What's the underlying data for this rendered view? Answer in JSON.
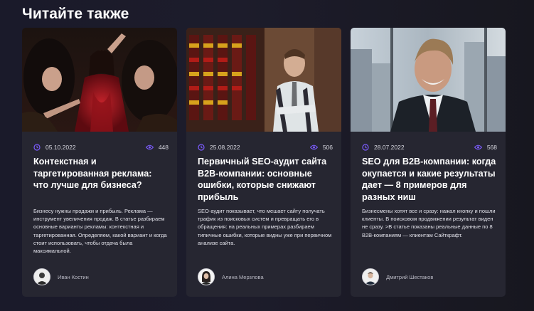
{
  "section": {
    "title": "Читайте также"
  },
  "colors": {
    "accent": "#7c5cff",
    "card_bg": "#262631",
    "page_bg": "#1b1a28"
  },
  "cards": [
    {
      "date": "05.10.2022",
      "views": "448",
      "title": "Контекстная и таргетированная реклама: что лучше для бизнеса?",
      "description": "Бизнесу нужны продажи и прибыль. Реклама — инструмент увеличения продаж. В статье разбираем основные варианты рекламы: контекстная и таргетированная. Определяем, какой вариант и когда стоит использовать, чтобы отдача была максимальной.",
      "author": "Иван Костин"
    },
    {
      "date": "25.08.2022",
      "views": "506",
      "title": "Первичный SEO-аудит сайта B2B-компании: основные ошибки, которые снижают прибыль",
      "description": "SEO-аудит показывает, что мешает сайту получать трафик из поисковых систем и превращать его в обращения: на реальных примерах разбираем типичные ошибки, которые видны уже при первичном анализе сайта.",
      "author": "Алина Мерзлова"
    },
    {
      "date": "28.07.2022",
      "views": "568",
      "title": "SEO для B2B-компании: когда окупается и какие результаты дает — 8 примеров для разных ниш",
      "description": "Бизнесмены хотят все и сразу: нажал кнопку и пошли клиенты. В поисковом продвижении результат виден не сразу. >В статье показаны реальные данные по 8 B2B-компаниям — клиентам Сайткрафт.",
      "author": "Дмитрий Шестаков"
    }
  ]
}
